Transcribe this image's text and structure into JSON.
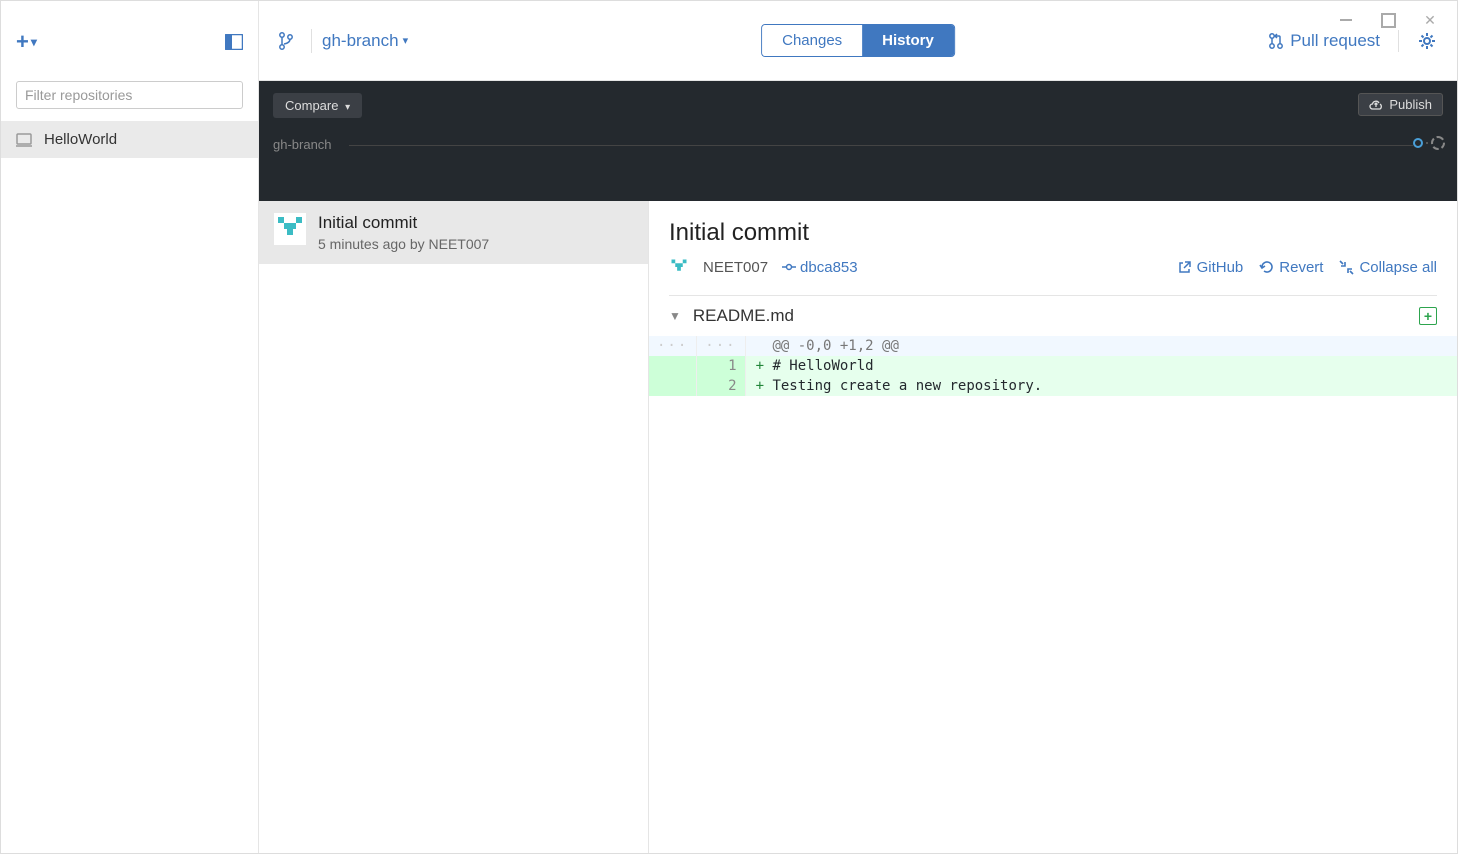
{
  "sidebar": {
    "filter_placeholder": "Filter repositories",
    "repo_name": "HelloWorld"
  },
  "topbar": {
    "branch_name": "gh-branch",
    "tab_changes": "Changes",
    "tab_history": "History",
    "pull_request": "Pull request"
  },
  "darkbar": {
    "compare_label": "Compare",
    "publish_label": "Publish",
    "branch_label": "gh-branch"
  },
  "commit": {
    "title": "Initial commit",
    "meta": "5 minutes ago by NEET007"
  },
  "detail": {
    "title": "Initial commit",
    "author": "NEET007",
    "sha": "dbca853",
    "github_label": "GitHub",
    "revert_label": "Revert",
    "collapse_label": "Collapse all",
    "file_name": "README.md"
  },
  "diff": {
    "hunk": "@@ -0,0 +1,2 @@",
    "line1_num": "1",
    "line1": "# HelloWorld",
    "line2_num": "2",
    "line2": "Testing create a new repository."
  }
}
